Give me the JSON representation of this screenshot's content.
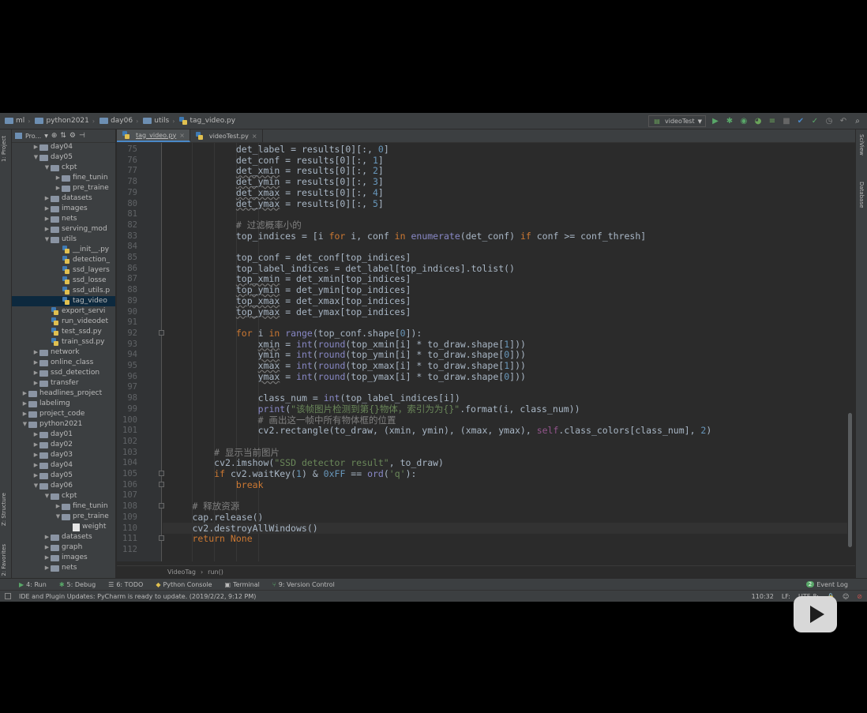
{
  "navbar": {
    "crumbs": [
      "ml",
      "python2021",
      "day06",
      "utils",
      "tag_video.py"
    ],
    "run_config": "videoTest"
  },
  "left_strip": {
    "project_tab": "1: Project",
    "structure_tab": "Z: Structure",
    "favorites_tab": "2: Favorites"
  },
  "right_strip": {
    "sciview_tab": "SciView",
    "database_tab": "Database"
  },
  "project_panel": {
    "header_label": "Pro..."
  },
  "tree": [
    {
      "label": "day04",
      "level": 2,
      "expanded": false,
      "kind": "folder"
    },
    {
      "label": "day05",
      "level": 2,
      "expanded": true,
      "kind": "folder"
    },
    {
      "label": "ckpt",
      "level": 3,
      "expanded": true,
      "kind": "folder"
    },
    {
      "label": "fine_tunin",
      "level": 4,
      "expanded": false,
      "kind": "folder"
    },
    {
      "label": "pre_traine",
      "level": 4,
      "expanded": false,
      "kind": "folder"
    },
    {
      "label": "datasets",
      "level": 3,
      "expanded": false,
      "kind": "folder"
    },
    {
      "label": "images",
      "level": 3,
      "expanded": false,
      "kind": "folder"
    },
    {
      "label": "nets",
      "level": 3,
      "expanded": false,
      "kind": "folder"
    },
    {
      "label": "serving_mod",
      "level": 3,
      "expanded": false,
      "kind": "folder"
    },
    {
      "label": "utils",
      "level": 3,
      "expanded": true,
      "kind": "folder"
    },
    {
      "label": "__init__.py",
      "level": 4,
      "kind": "py"
    },
    {
      "label": "detection_",
      "level": 4,
      "kind": "py"
    },
    {
      "label": "ssd_layers",
      "level": 4,
      "kind": "py"
    },
    {
      "label": "ssd_losse",
      "level": 4,
      "kind": "py"
    },
    {
      "label": "ssd_utils.p",
      "level": 4,
      "kind": "py"
    },
    {
      "label": "tag_video",
      "level": 4,
      "kind": "py",
      "selected": true
    },
    {
      "label": "export_servi",
      "level": 3,
      "kind": "py"
    },
    {
      "label": "run_videodet",
      "level": 3,
      "kind": "py"
    },
    {
      "label": "test_ssd.py",
      "level": 3,
      "kind": "py"
    },
    {
      "label": "train_ssd.py",
      "level": 3,
      "kind": "py"
    },
    {
      "label": "network",
      "level": 2,
      "expanded": false,
      "kind": "folder"
    },
    {
      "label": "online_class",
      "level": 2,
      "expanded": false,
      "kind": "folder"
    },
    {
      "label": "ssd_detection",
      "level": 2,
      "expanded": false,
      "kind": "folder"
    },
    {
      "label": "transfer",
      "level": 2,
      "expanded": false,
      "kind": "folder"
    },
    {
      "label": "headlines_project",
      "level": 1,
      "expanded": false,
      "kind": "folder"
    },
    {
      "label": "labelimg",
      "level": 1,
      "expanded": false,
      "kind": "folder"
    },
    {
      "label": "project_code",
      "level": 1,
      "expanded": false,
      "kind": "folder"
    },
    {
      "label": "python2021",
      "level": 1,
      "expanded": true,
      "kind": "folder"
    },
    {
      "label": "day01",
      "level": 2,
      "expanded": false,
      "kind": "folder"
    },
    {
      "label": "day02",
      "level": 2,
      "expanded": false,
      "kind": "folder"
    },
    {
      "label": "day03",
      "level": 2,
      "expanded": false,
      "kind": "folder"
    },
    {
      "label": "day04",
      "level": 2,
      "expanded": false,
      "kind": "folder"
    },
    {
      "label": "day05",
      "level": 2,
      "expanded": false,
      "kind": "folder"
    },
    {
      "label": "day06",
      "level": 2,
      "expanded": true,
      "kind": "folder"
    },
    {
      "label": "ckpt",
      "level": 3,
      "expanded": true,
      "kind": "folder"
    },
    {
      "label": "fine_tunin",
      "level": 4,
      "expanded": false,
      "kind": "folder"
    },
    {
      "label": "pre_traine",
      "level": 4,
      "expanded": true,
      "kind": "folder"
    },
    {
      "label": "weight",
      "level": 5,
      "kind": "file"
    },
    {
      "label": "datasets",
      "level": 3,
      "expanded": false,
      "kind": "folder"
    },
    {
      "label": "graph",
      "level": 3,
      "expanded": false,
      "kind": "folder"
    },
    {
      "label": "images",
      "level": 3,
      "expanded": false,
      "kind": "folder"
    },
    {
      "label": "nets",
      "level": 3,
      "expanded": false,
      "kind": "folder"
    }
  ],
  "tabs": [
    {
      "label": "tag_video.py",
      "active": true
    },
    {
      "label": "videoTest.py",
      "active": false
    }
  ],
  "code": {
    "current_line": 110,
    "lines": [
      {
        "n": 75,
        "indent": 16,
        "segs": [
          [
            "",
            "det_label = results[0][:, "
          ],
          [
            "nm",
            "0"
          ],
          [
            "",
            "]"
          ]
        ]
      },
      {
        "n": 76,
        "indent": 16,
        "segs": [
          [
            "",
            "det_conf = results[0][:, "
          ],
          [
            "nm",
            "1"
          ],
          [
            "",
            "]"
          ]
        ]
      },
      {
        "n": 77,
        "indent": 16,
        "segs": [
          [
            "var",
            "det_xmin"
          ],
          [
            "",
            " = results[0][:, "
          ],
          [
            "nm",
            "2"
          ],
          [
            "",
            "]"
          ]
        ]
      },
      {
        "n": 78,
        "indent": 16,
        "segs": [
          [
            "var",
            "det_ymin"
          ],
          [
            "",
            " = results[0][:, "
          ],
          [
            "nm",
            "3"
          ],
          [
            "",
            "]"
          ]
        ]
      },
      {
        "n": 79,
        "indent": 16,
        "segs": [
          [
            "var",
            "det_xmax"
          ],
          [
            "",
            " = results[0][:, "
          ],
          [
            "nm",
            "4"
          ],
          [
            "",
            "]"
          ]
        ]
      },
      {
        "n": 80,
        "indent": 16,
        "segs": [
          [
            "var",
            "det_ymax"
          ],
          [
            "",
            " = results[0][:, "
          ],
          [
            "nm",
            "5"
          ],
          [
            "",
            "]"
          ]
        ]
      },
      {
        "n": 81,
        "indent": 0,
        "segs": []
      },
      {
        "n": 82,
        "indent": 16,
        "segs": [
          [
            "cm",
            "# 过滤概率小的"
          ]
        ]
      },
      {
        "n": 83,
        "indent": 16,
        "segs": [
          [
            "",
            "top_indices = [i "
          ],
          [
            "kw",
            "for"
          ],
          [
            "",
            " i, conf "
          ],
          [
            "kw",
            "in"
          ],
          [
            "",
            " "
          ],
          [
            "bi",
            "enumerate"
          ],
          [
            "",
            "(det_conf) "
          ],
          [
            "kw",
            "if"
          ],
          [
            "",
            " conf >= conf_thresh]"
          ]
        ]
      },
      {
        "n": 84,
        "indent": 0,
        "segs": []
      },
      {
        "n": 85,
        "indent": 16,
        "segs": [
          [
            "",
            "top_conf = det_conf[top_indices]"
          ]
        ]
      },
      {
        "n": 86,
        "indent": 16,
        "segs": [
          [
            "",
            "top_label_indices = det_label[top_indices].tolist()"
          ]
        ]
      },
      {
        "n": 87,
        "indent": 16,
        "segs": [
          [
            "var",
            "top_xmin"
          ],
          [
            "",
            " = det_xmin[top_indices]"
          ]
        ]
      },
      {
        "n": 88,
        "indent": 16,
        "segs": [
          [
            "var",
            "top_ymin"
          ],
          [
            "",
            " = det_ymin[top_indices]"
          ]
        ]
      },
      {
        "n": 89,
        "indent": 16,
        "segs": [
          [
            "var",
            "top_xmax"
          ],
          [
            "",
            " = det_xmax[top_indices]"
          ]
        ]
      },
      {
        "n": 90,
        "indent": 16,
        "segs": [
          [
            "var",
            "top_ymax"
          ],
          [
            "",
            " = det_ymax[top_indices]"
          ]
        ]
      },
      {
        "n": 91,
        "indent": 0,
        "segs": []
      },
      {
        "n": 92,
        "indent": 16,
        "segs": [
          [
            "kw",
            "for"
          ],
          [
            "",
            " i "
          ],
          [
            "kw",
            "in"
          ],
          [
            "",
            " "
          ],
          [
            "bi",
            "range"
          ],
          [
            "",
            "(top_conf.shape["
          ],
          [
            "nm",
            "0"
          ],
          [
            "",
            "]):"
          ]
        ]
      },
      {
        "n": 93,
        "indent": 20,
        "segs": [
          [
            "var",
            "xmin"
          ],
          [
            "",
            " = "
          ],
          [
            "bi",
            "int"
          ],
          [
            "",
            "("
          ],
          [
            "bi",
            "round"
          ],
          [
            "",
            "(top_xmin[i] * to_draw.shape["
          ],
          [
            "nm",
            "1"
          ],
          [
            "",
            "]))"
          ]
        ]
      },
      {
        "n": 94,
        "indent": 20,
        "segs": [
          [
            "var",
            "ymin"
          ],
          [
            "",
            " = "
          ],
          [
            "bi",
            "int"
          ],
          [
            "",
            "("
          ],
          [
            "bi",
            "round"
          ],
          [
            "",
            "(top_ymin[i] * to_draw.shape["
          ],
          [
            "nm",
            "0"
          ],
          [
            "",
            "]))"
          ]
        ]
      },
      {
        "n": 95,
        "indent": 20,
        "segs": [
          [
            "var",
            "xmax"
          ],
          [
            "",
            " = "
          ],
          [
            "bi",
            "int"
          ],
          [
            "",
            "("
          ],
          [
            "bi",
            "round"
          ],
          [
            "",
            "(top_xmax[i] * to_draw.shape["
          ],
          [
            "nm",
            "1"
          ],
          [
            "",
            "]))"
          ]
        ]
      },
      {
        "n": 96,
        "indent": 20,
        "segs": [
          [
            "var",
            "ymax"
          ],
          [
            "",
            " = "
          ],
          [
            "bi",
            "int"
          ],
          [
            "",
            "("
          ],
          [
            "bi",
            "round"
          ],
          [
            "",
            "(top_ymax[i] * to_draw.shape["
          ],
          [
            "nm",
            "0"
          ],
          [
            "",
            "]))"
          ]
        ]
      },
      {
        "n": 97,
        "indent": 0,
        "segs": []
      },
      {
        "n": 98,
        "indent": 20,
        "segs": [
          [
            "",
            "class_num = "
          ],
          [
            "bi",
            "int"
          ],
          [
            "",
            "(top_label_indices[i])"
          ]
        ]
      },
      {
        "n": 99,
        "indent": 20,
        "segs": [
          [
            "bi",
            "print"
          ],
          [
            "",
            "("
          ],
          [
            "st",
            "\"该帧图片检测到第{}物体，索引为为{}\""
          ],
          [
            "",
            ".format(i, class_num))"
          ]
        ]
      },
      {
        "n": 100,
        "indent": 20,
        "segs": [
          [
            "cm",
            "# 画出这一帧中所有物体框的位置"
          ]
        ]
      },
      {
        "n": 101,
        "indent": 20,
        "segs": [
          [
            "",
            "cv2.rectangle(to_draw, (xmin, ymin), (xmax, ymax), "
          ],
          [
            "sf",
            "self"
          ],
          [
            "",
            ".class_colors[class_num], "
          ],
          [
            "nm",
            "2"
          ],
          [
            "",
            ")"
          ]
        ]
      },
      {
        "n": 102,
        "indent": 0,
        "segs": []
      },
      {
        "n": 103,
        "indent": 12,
        "segs": [
          [
            "cm",
            "# 显示当前图片"
          ]
        ]
      },
      {
        "n": 104,
        "indent": 12,
        "segs": [
          [
            "",
            "cv2.imshow("
          ],
          [
            "st",
            "\"SSD detector result\""
          ],
          [
            "",
            ", to_draw)"
          ]
        ]
      },
      {
        "n": 105,
        "indent": 12,
        "segs": [
          [
            "kw",
            "if"
          ],
          [
            "",
            " cv2.waitKey("
          ],
          [
            "nm",
            "1"
          ],
          [
            "",
            ") & "
          ],
          [
            "nm",
            "0xFF"
          ],
          [
            "",
            " == "
          ],
          [
            "bi",
            "ord"
          ],
          [
            "",
            "("
          ],
          [
            "st",
            "'q'"
          ],
          [
            "",
            "):"
          ]
        ]
      },
      {
        "n": 106,
        "indent": 16,
        "segs": [
          [
            "kw",
            "break"
          ]
        ]
      },
      {
        "n": 107,
        "indent": 0,
        "segs": []
      },
      {
        "n": 108,
        "indent": 8,
        "segs": [
          [
            "cm",
            "# 释放资源"
          ]
        ]
      },
      {
        "n": 109,
        "indent": 8,
        "segs": [
          [
            "",
            "cap.release()"
          ]
        ]
      },
      {
        "n": 110,
        "indent": 8,
        "segs": [
          [
            "",
            "cv2.destroyAllWindows()"
          ]
        ]
      },
      {
        "n": 111,
        "indent": 8,
        "segs": [
          [
            "kw",
            "return"
          ],
          [
            "",
            " "
          ],
          [
            "kw",
            "None"
          ]
        ]
      },
      {
        "n": 112,
        "indent": 0,
        "segs": []
      }
    ]
  },
  "editor_breadcrumb": [
    "VideoTag",
    "run()"
  ],
  "bottom_tools": [
    {
      "label": "4: Run",
      "icon": "run-icon"
    },
    {
      "label": "5: Debug",
      "icon": "debug-icon"
    },
    {
      "label": "6: TODO",
      "icon": "todo-icon"
    },
    {
      "label": "Python Console",
      "icon": "python-console-icon"
    },
    {
      "label": "Terminal",
      "icon": "terminal-icon"
    },
    {
      "label": "9: Version Control",
      "icon": "version-control-icon"
    }
  ],
  "event_log": {
    "badge": "2",
    "label": "Event Log"
  },
  "status": {
    "message": "IDE and Plugin Updates: PyCharm is ready to update. (2019/2/22, 9:12 PM)",
    "position": "110:32",
    "line_sep": "LF:",
    "encoding": "UTF-8:"
  }
}
